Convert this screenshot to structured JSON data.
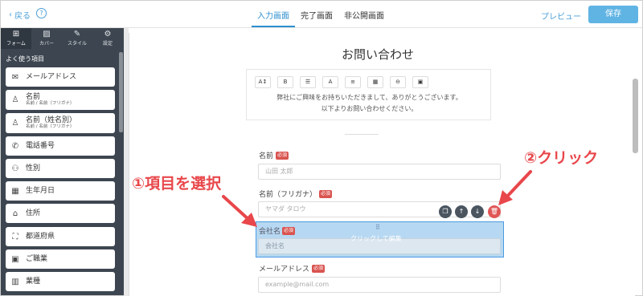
{
  "topbar": {
    "back_label": "戻る",
    "help_label": "?",
    "tabs": [
      "入力画面",
      "完了画面",
      "非公開画面"
    ],
    "preview_label": "プレビュー",
    "save_label": "保存"
  },
  "sidebar": {
    "tabs": [
      {
        "label": "フォーム",
        "icon": "form-icon"
      },
      {
        "label": "カバー",
        "icon": "image-icon"
      },
      {
        "label": "スタイル",
        "icon": "brush-icon"
      },
      {
        "label": "設定",
        "icon": "gear-icon"
      }
    ],
    "section_label": "よく使う項目",
    "items": [
      {
        "label": "メールアドレス",
        "sub": "",
        "icon": "mail-icon"
      },
      {
        "label": "名前",
        "sub": "名前 / 名前（フリガナ）",
        "icon": "person-icon"
      },
      {
        "label": "名前（姓名別）",
        "sub": "名前 / 名前（フリガナ）",
        "icon": "person-icon"
      },
      {
        "label": "電話番号",
        "sub": "",
        "icon": "phone-icon"
      },
      {
        "label": "性別",
        "sub": "",
        "icon": "gender-icon"
      },
      {
        "label": "生年月日",
        "sub": "",
        "icon": "calendar-icon"
      },
      {
        "label": "住所",
        "sub": "",
        "icon": "home-icon"
      },
      {
        "label": "都道府県",
        "sub": "",
        "icon": "map-icon"
      },
      {
        "label": "ご職業",
        "sub": "",
        "icon": "badge-icon"
      },
      {
        "label": "業種",
        "sub": "",
        "icon": "building-icon"
      }
    ]
  },
  "form": {
    "title": "お問い合わせ",
    "toolbar": [
      "A↕",
      "B",
      "☰",
      "A",
      "≡",
      "▦",
      "⊖",
      "▣"
    ],
    "intro_line1": "弊社にご興味をお持ちいただきまして、ありがとうございます。",
    "intro_line2": "以下よりお問い合わせください。",
    "required_badge": "必須",
    "fields": [
      {
        "label": "名前",
        "placeholder": "山田 太郎"
      },
      {
        "label": "名前（フリガナ）",
        "placeholder": "ヤマダ タロウ"
      },
      {
        "label": "会社名",
        "placeholder": "会社名"
      },
      {
        "label": "メールアドレス",
        "placeholder": "example@mail.com"
      }
    ],
    "selected_overlay": "クリックして編集",
    "drag_handle": "⠿"
  },
  "annotations": {
    "step1": "①項目を選択",
    "step2": "②クリック",
    "color": "#e8474b"
  },
  "colors": {
    "accent": "#2e8fcf",
    "save_button": "#5fb4e3",
    "sidebar_bg": "#3d4650",
    "selection": "#b7d8f2",
    "required": "#d9534f"
  }
}
